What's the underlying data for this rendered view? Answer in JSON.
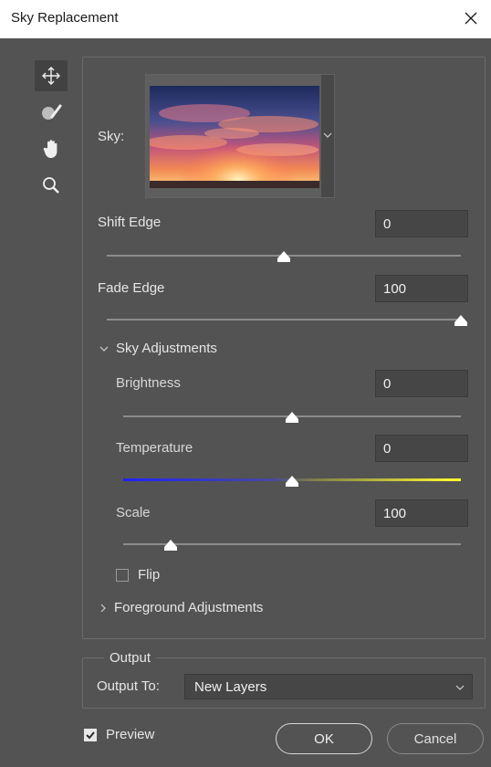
{
  "window": {
    "title": "Sky Replacement"
  },
  "tools": [
    {
      "name": "move-icon"
    },
    {
      "name": "sky-brush-icon"
    },
    {
      "name": "hand-icon"
    },
    {
      "name": "zoom-icon"
    }
  ],
  "sky": {
    "label": "Sky:"
  },
  "shift_edge": {
    "label": "Shift Edge",
    "value": "0",
    "position": 0.5
  },
  "fade_edge": {
    "label": "Fade Edge",
    "value": "100",
    "position": 1.0
  },
  "sky_adjustments": {
    "label": "Sky Adjustments",
    "brightness": {
      "label": "Brightness",
      "value": "0",
      "position": 0.5
    },
    "temperature": {
      "label": "Temperature",
      "value": "0",
      "position": 0.5
    },
    "scale": {
      "label": "Scale",
      "value": "100",
      "position": 0.14
    },
    "flip": {
      "label": "Flip",
      "checked": false
    }
  },
  "foreground_adjustments": {
    "label": "Foreground Adjustments"
  },
  "output": {
    "title": "Output",
    "output_to_label": "Output To:",
    "output_to_value": "New Layers"
  },
  "preview": {
    "label": "Preview",
    "checked": true
  },
  "buttons": {
    "ok": "OK",
    "cancel": "Cancel"
  },
  "colors": {
    "background": "#535353",
    "input": "#464646",
    "temp_cold": "#2020ff",
    "temp_warm": "#ffff30"
  }
}
